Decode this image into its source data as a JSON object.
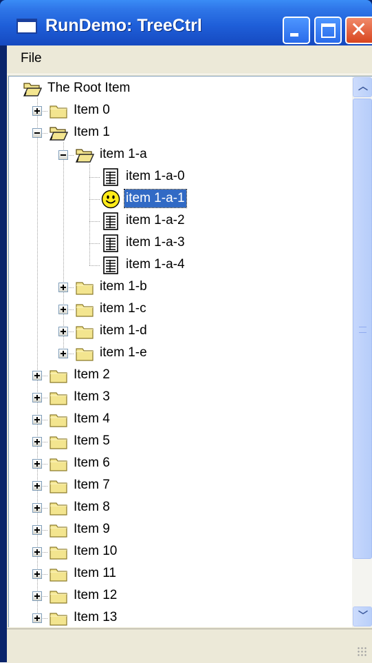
{
  "window": {
    "title": "RunDemo: TreeCtrl",
    "title_icon": "window-icon",
    "controls": [
      "minimize-icon",
      "maximize-icon",
      "close-icon"
    ]
  },
  "menu": {
    "items": [
      "File"
    ]
  },
  "tree": {
    "selected": "item 1-a-1",
    "rows": [
      {
        "label": "The Root Item",
        "level": 0,
        "icon": "folder-open-icon",
        "expander": "none"
      },
      {
        "label": "Item 0",
        "level": 1,
        "icon": "folder-icon",
        "expander": "plus"
      },
      {
        "label": "Item 1",
        "level": 1,
        "icon": "folder-open-icon",
        "expander": "minus"
      },
      {
        "label": "item 1-a",
        "level": 2,
        "icon": "folder-open-icon",
        "expander": "minus"
      },
      {
        "label": "item 1-a-0",
        "level": 3,
        "icon": "document-icon",
        "expander": "none"
      },
      {
        "label": "item 1-a-1",
        "level": 3,
        "icon": "smiley-icon",
        "expander": "none"
      },
      {
        "label": "item 1-a-2",
        "level": 3,
        "icon": "document-icon",
        "expander": "none"
      },
      {
        "label": "item 1-a-3",
        "level": 3,
        "icon": "document-icon",
        "expander": "none"
      },
      {
        "label": "item 1-a-4",
        "level": 3,
        "icon": "document-icon",
        "expander": "none"
      },
      {
        "label": "item 1-b",
        "level": 2,
        "icon": "folder-icon",
        "expander": "plus"
      },
      {
        "label": "item 1-c",
        "level": 2,
        "icon": "folder-icon",
        "expander": "plus"
      },
      {
        "label": "item 1-d",
        "level": 2,
        "icon": "folder-icon",
        "expander": "plus"
      },
      {
        "label": "item 1-e",
        "level": 2,
        "icon": "folder-icon",
        "expander": "plus"
      },
      {
        "label": "Item 2",
        "level": 1,
        "icon": "folder-icon",
        "expander": "plus"
      },
      {
        "label": "Item 3",
        "level": 1,
        "icon": "folder-icon",
        "expander": "plus"
      },
      {
        "label": "Item 4",
        "level": 1,
        "icon": "folder-icon",
        "expander": "plus"
      },
      {
        "label": "Item 5",
        "level": 1,
        "icon": "folder-icon",
        "expander": "plus"
      },
      {
        "label": "Item 6",
        "level": 1,
        "icon": "folder-icon",
        "expander": "plus"
      },
      {
        "label": "Item 7",
        "level": 1,
        "icon": "folder-icon",
        "expander": "plus"
      },
      {
        "label": "Item 8",
        "level": 1,
        "icon": "folder-icon",
        "expander": "plus"
      },
      {
        "label": "Item 9",
        "level": 1,
        "icon": "folder-icon",
        "expander": "plus"
      },
      {
        "label": "Item 10",
        "level": 1,
        "icon": "folder-icon",
        "expander": "plus"
      },
      {
        "label": "Item 11",
        "level": 1,
        "icon": "folder-icon",
        "expander": "plus"
      },
      {
        "label": "Item 12",
        "level": 1,
        "icon": "folder-icon",
        "expander": "plus"
      },
      {
        "label": "Item 13",
        "level": 1,
        "icon": "folder-icon",
        "expander": "plus"
      }
    ]
  },
  "colors": {
    "titlebar": "#2f76e8",
    "selection": "#316ac5",
    "folder": "#f3e58f",
    "chrome": "#ece9d8"
  }
}
